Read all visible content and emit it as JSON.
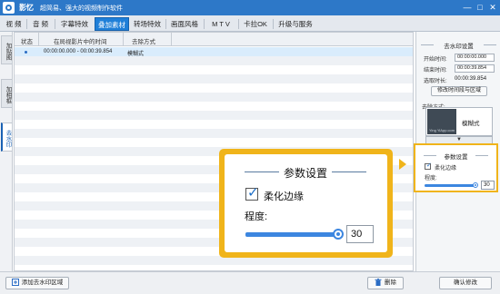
{
  "titlebar": {
    "app_name": "影忆",
    "slogan": "超简易、强大的视频制作软件",
    "minimize_glyph": "—",
    "maximize_glyph": "□",
    "close_glyph": "✕"
  },
  "menu": {
    "tabs": [
      {
        "label": "视  频"
      },
      {
        "label": "音  频"
      },
      {
        "label": "字幕特效"
      },
      {
        "label": "叠加素材"
      },
      {
        "label": "转场特效"
      },
      {
        "label": "画面风格"
      },
      {
        "label": "M T V"
      },
      {
        "label": "卡拉OK"
      },
      {
        "label": "升级与服务"
      }
    ],
    "active_index": 3
  },
  "side_tabs": [
    {
      "label": "加贴图"
    },
    {
      "label": "加相框"
    },
    {
      "label": "去水印"
    }
  ],
  "list": {
    "columns": [
      "状态",
      "在局视影片中的时间",
      "去除方式"
    ],
    "rows": [
      {
        "time": "00:00:00.000 - 00:00:39.854",
        "method": "模糊式"
      }
    ]
  },
  "bottom": {
    "add_region_label": "添加去水印区域",
    "delete_label": "删除",
    "confirm_label": "确认修改"
  },
  "right_panel": {
    "section_title": "去水印设置",
    "start_label": "开始时间:",
    "start_value": "00:00:00.000",
    "end_label": "结束时间:",
    "end_value": "00:00:39.854",
    "duration_label": "选取时长:",
    "duration_value": "00:00:39.854",
    "modify_button": "修改时间段与区域",
    "method_label": "去除方式:",
    "thumb_caption": "Ying YiApp.com",
    "method_value": "模糊式",
    "dropdown_glyph": "▼"
  },
  "params": {
    "title": "参数设置",
    "soften_label": "柔化边缘",
    "soften_checked": true,
    "level_label": "程度:",
    "level_value": "30",
    "level_fraction": 0.96
  },
  "colors": {
    "titlebar": "#2d78c8",
    "active_tab": "#1f7fd8",
    "highlight": "#f0b41a",
    "slider": "#3c86e0"
  }
}
